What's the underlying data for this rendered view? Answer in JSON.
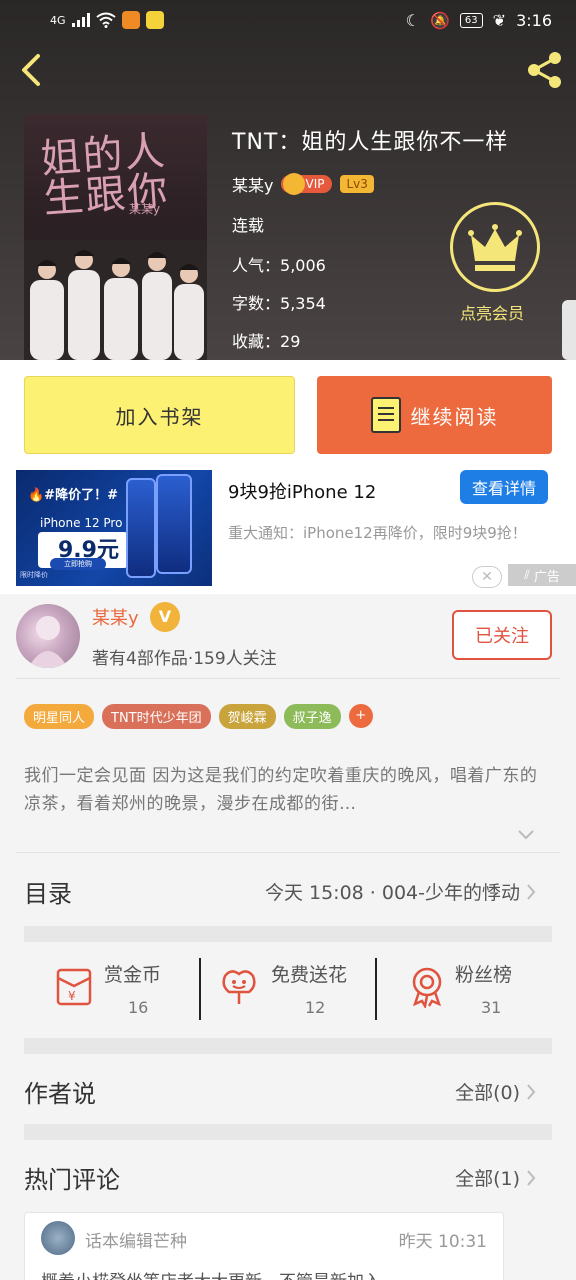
{
  "status_bar": {
    "network": "4G",
    "battery": "63",
    "time": "3:16"
  },
  "book": {
    "title": "TNT：姐的人生跟你不一样",
    "cover_title": "姐的人生跟你",
    "cover_sub": "某某y",
    "author": "某某y",
    "vip_label": "VIP",
    "level_label": "Lv3",
    "status": "连载",
    "popularity_label": "人气：",
    "popularity": "5,006",
    "word_count_label": "字数：",
    "word_count": "5,354",
    "favorites_label": "收藏：",
    "favorites": "29"
  },
  "member": {
    "label": "点亮会员"
  },
  "actions": {
    "add_to_shelf": "加入书架",
    "continue_reading": "继续阅读"
  },
  "ad": {
    "image_tag": "🔥#降价了！#",
    "image_model": "iPhone 12 Pro",
    "image_price": "9.9元",
    "image_buy": "立即抢购",
    "image_footer": "限时降价",
    "title": "9块9抢iPhone 12",
    "detail_button": "查看详情",
    "description": "重大通知：iPhone12再降价，限时9块9抢！",
    "label": "广告",
    "close": "✕"
  },
  "author_card": {
    "name": "某某y",
    "verified": "V",
    "stats": "著有4部作品·159人关注",
    "follow_button": "已关注",
    "tags": [
      {
        "label": "明星同人",
        "color": "#f3a93b"
      },
      {
        "label": "TNT时代少年团",
        "color": "#d9705a"
      },
      {
        "label": "贺峻霖",
        "color": "#c9a33c"
      },
      {
        "label": "叔子逸",
        "color": "#8dbb5a"
      }
    ],
    "tag_more": "+",
    "intro": "我们一定会见面 因为这是我们的约定吹着重庆的晚风，唱着广东的凉茶，看着郑州的晚景，漫步在成都的街…"
  },
  "catalog": {
    "title": "目录",
    "latest": "今天 15:08 · 004-少年的悸动"
  },
  "rewards": [
    {
      "title": "赏金币",
      "value": "16",
      "icon": "envelope-icon"
    },
    {
      "title": "免费送花",
      "value": "12",
      "icon": "flower-icon"
    },
    {
      "title": "粉丝榜",
      "value": "31",
      "icon": "medal-icon"
    }
  ],
  "author_says": {
    "title": "作者说",
    "all": "全部(0)"
  },
  "hot_comments": {
    "title": "热门评论",
    "all": "全部(1)",
    "items": [
      {
        "user": "话本编辑芒种",
        "time": "昨天 10:31",
        "text": "概着小椛登坐等店者大大更新，不管是新加入"
      }
    ]
  },
  "colors": {
    "accent_orange": "#ec6a3d",
    "shelf_yellow": "#fdf173",
    "member_gold": "#f5e67a",
    "follow_red": "#e0533f",
    "ad_blue": "#1e7ee6"
  }
}
